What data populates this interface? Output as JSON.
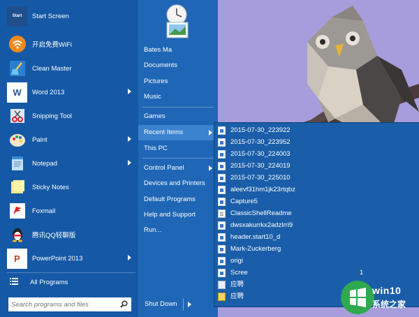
{
  "programs": [
    {
      "label": "Start Screen",
      "icon": "start-screen-icon",
      "tile_text": "Start"
    },
    {
      "label": "开启免费WiFi",
      "icon": "wifi-icon"
    },
    {
      "label": "Clean Master",
      "icon": "broom-icon"
    },
    {
      "label": "Word 2013",
      "icon": "word-icon",
      "has_submenu": true,
      "tile_text": "W"
    },
    {
      "label": "Snipping Tool",
      "icon": "scissors-icon"
    },
    {
      "label": "Paint",
      "icon": "palette-icon",
      "has_submenu": true
    },
    {
      "label": "Notepad",
      "icon": "notepad-icon",
      "has_submenu": true
    },
    {
      "label": "Sticky Notes",
      "icon": "sticky-notes-icon"
    },
    {
      "label": "Foxmail",
      "icon": "foxmail-icon"
    },
    {
      "label": "腾讯QQ轻聊版",
      "icon": "qq-penguin-icon"
    },
    {
      "label": "PowerPoint 2013",
      "icon": "powerpoint-icon",
      "has_submenu": true,
      "tile_text": "P"
    }
  ],
  "all_programs": "All Programs",
  "search": {
    "placeholder": "Search programs and files"
  },
  "places": [
    {
      "label": "Bates Ma"
    },
    {
      "label": "Documents"
    },
    {
      "label": "Pictures"
    },
    {
      "label": "Music"
    },
    {
      "label": "Games"
    },
    {
      "label": "Recent Items",
      "has_submenu": true,
      "highlighted": true
    },
    {
      "label": "This PC"
    },
    {
      "label": "Control Panel",
      "has_submenu": true
    },
    {
      "label": "Devices and Printers"
    },
    {
      "label": "Default Programs"
    },
    {
      "label": "Help and Support"
    },
    {
      "label": "Run..."
    }
  ],
  "shutdown": "Shut Down",
  "recent_items": [
    {
      "label": "2015-07-30_223922",
      "icon": "image-file-icon"
    },
    {
      "label": "2015-07-30_223952",
      "icon": "image-file-icon"
    },
    {
      "label": "2015-07-30_224003",
      "icon": "image-file-icon"
    },
    {
      "label": "2015-07-30_224019",
      "icon": "image-file-icon"
    },
    {
      "label": "2015-07-30_225010",
      "icon": "image-file-icon"
    },
    {
      "label": "aleevf31hm1jk23rtqbz",
      "icon": "image-file-icon"
    },
    {
      "label": "Capture5",
      "icon": "image-file-icon"
    },
    {
      "label": "ClassicShellReadme",
      "icon": "text-file-icon"
    },
    {
      "label": "dwsxakurrkx2adzlrri9",
      "icon": "image-file-icon"
    },
    {
      "label": "header.start10_d",
      "icon": "image-file-icon"
    },
    {
      "label": "Mark-Zuckerberg",
      "icon": "image-file-icon"
    },
    {
      "label": "origi",
      "icon": "image-file-icon"
    },
    {
      "label": "Scree",
      "suffix": "1",
      "icon": "image-file-icon"
    },
    {
      "label": "应聘",
      "icon": "document-file-icon"
    },
    {
      "label": "应聘",
      "icon": "zip-file-icon"
    }
  ],
  "watermark": {
    "line1": "win10",
    "line2": "系统之家"
  },
  "colors": {
    "menu_left": "#1559a6",
    "menu_right": "#1f67b6",
    "highlight": "#3b82cf",
    "wallpaper": "#a79ddc"
  }
}
